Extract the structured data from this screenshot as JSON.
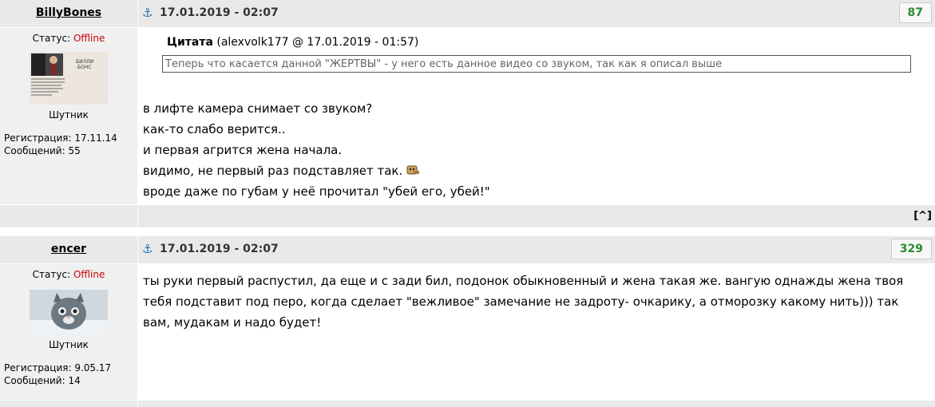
{
  "posts": [
    {
      "author": "BillyBones",
      "date": "17.01.2019 - 02:07",
      "score": "87",
      "status_label": "Статус:",
      "status_value": "Offline",
      "rank": "Шутник",
      "reg_label": "Регистрация:",
      "reg_date": "17.11.14",
      "msgs_label": "Сообщений:",
      "msgs_count": "55",
      "quote": {
        "title": "Цитата",
        "meta": "(alexvolk177 @ 17.01.2019 - 01:57)",
        "text": "Теперь что касается данной \"ЖЕРТВЫ\" - у него есть данное видео со звуком, так как я описал выше"
      },
      "lines": [
        "в лифте камера снимает со звуком?",
        "как-то слабо верится..",
        "и первая агрится жена начала.",
        "видимо, не первый раз подставляет так.",
        "вроде даже по губам у неё прочитал \"убей его, убей!\""
      ],
      "emoji": "thinking-emoji",
      "top_link": "[^]"
    },
    {
      "author": "encer",
      "date": "17.01.2019 - 02:07",
      "score": "329",
      "status_label": "Статус:",
      "status_value": "Offline",
      "rank": "Шутник",
      "reg_label": "Регистрация:",
      "reg_date": "9.05.17",
      "msgs_label": "Сообщений:",
      "msgs_count": "14",
      "text": "ты руки первый распустил, да еще и с зади бил, подонок обыкновенный и жена такая же. вангую однажды жена твоя тебя подставит под перо, когда сделает \"вежливое\" замечание не задроту- очкарику, а отморозку какому нить))) так вам, мудакам и надо будет!"
    }
  ],
  "colors": {
    "offline": "#cc0000",
    "score": "#2a8a2a",
    "anchor": "#1d6fb5"
  }
}
